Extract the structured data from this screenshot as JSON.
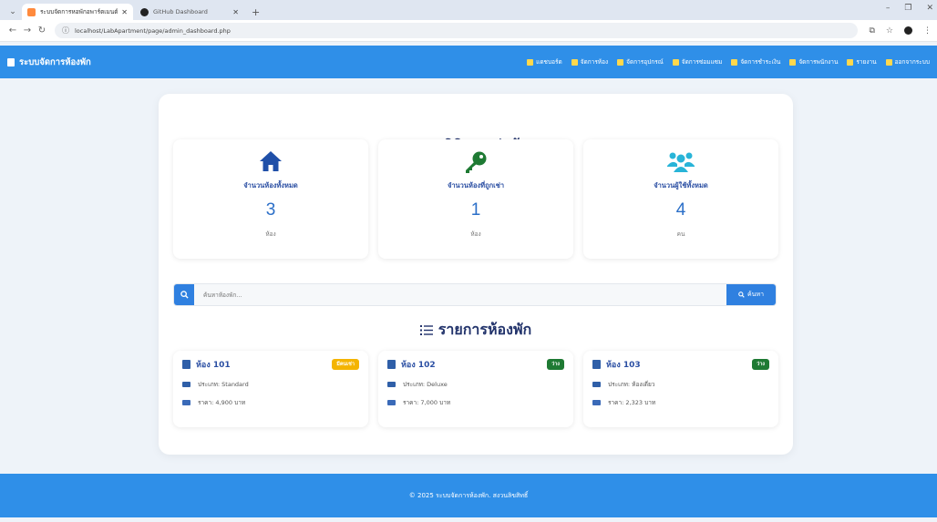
{
  "browser": {
    "tabs": [
      {
        "title": "ระบบจัดการหอพักอพาร์ตเมนต์ - ระบบจัดการ",
        "active": true
      },
      {
        "title": "GitHub Dashboard",
        "active": false
      }
    ],
    "url": "localhost/LabApartment/page/admin_dashboard.php"
  },
  "navbar": {
    "brand": "ระบบจัดการห้องพัก",
    "menu": [
      "แดชบอร์ด",
      "จัดการห้อง",
      "จัดการอุปกรณ์",
      "จัดการซ่อมแซม",
      "จัดการชำระเงิน",
      "จัดการพนักงาน",
      "รายงาน",
      "ออกจากระบบ"
    ]
  },
  "stats": {
    "title": "สถิติการเช่าห้อง",
    "cards": [
      {
        "label": "จำนวนห้องทั้งหมด",
        "value": "3",
        "unit": "ห้อง",
        "icon": "home-icon",
        "color": "#1f4fa8"
      },
      {
        "label": "จำนวนห้องที่ถูกเช่า",
        "value": "1",
        "unit": "ห้อง",
        "icon": "key-icon",
        "color": "#1e7a33"
      },
      {
        "label": "จำนวนผู้ใช้ทั้งหมด",
        "value": "4",
        "unit": "คน",
        "icon": "users-icon",
        "color": "#28b4d8"
      }
    ]
  },
  "search": {
    "placeholder": "ค้นหาห้องพัก...",
    "button_label": "ค้นหา"
  },
  "rooms": {
    "title": "รายการห้องพัก",
    "items": [
      {
        "name": "ห้อง 101",
        "badge": "มีคนเช่า",
        "badge_color": "#f4b400",
        "type": "ประเภท: Standard",
        "price": "ราคา: 4,900 บาท"
      },
      {
        "name": "ห้อง 102",
        "badge": "ว่าง",
        "badge_color": "#1e7a33",
        "type": "ประเภท: Deluxe",
        "price": "ราคา: 7,000 บาท"
      },
      {
        "name": "ห้อง 103",
        "badge": "ว่าง",
        "badge_color": "#1e7a33",
        "type": "ประเภท: ห้องเดี่ยว",
        "price": "ราคา: 2,323 บาท"
      }
    ]
  },
  "footer": {
    "text": "© 2025 ระบบจัดการห้องพัก. สงวนลิขสิทธิ์"
  },
  "colors": {
    "primary": "#2f8fe8",
    "heading": "#22336b"
  }
}
